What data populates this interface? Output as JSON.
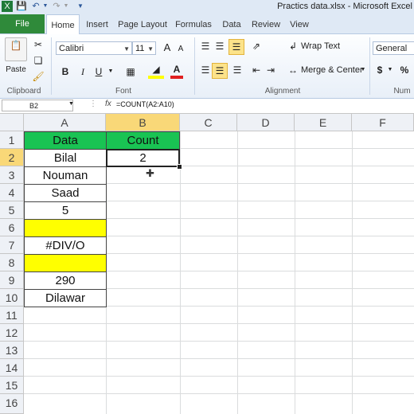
{
  "window": {
    "title": "Practics data.xlsx - Microsoft Excel"
  },
  "tabs": [
    "File",
    "Home",
    "Insert",
    "Page Layout",
    "Formulas",
    "Data",
    "Review",
    "View"
  ],
  "active_tab": "Home",
  "ribbon": {
    "clipboard": {
      "paste": "Paste",
      "label": "Clipboard"
    },
    "font": {
      "family": "Calibri",
      "size": "11",
      "label": "Font",
      "bold": "B",
      "italic": "I",
      "underline": "U",
      "grow": "A",
      "shrink": "A",
      "font_color_letter": "A"
    },
    "alignment": {
      "wrap_text": "Wrap Text",
      "merge_center": "Merge & Center",
      "label": "Alignment"
    },
    "number": {
      "format": "General",
      "currency": "$",
      "percent": "%",
      "label": "Num"
    }
  },
  "formula_bar": {
    "name_box": "B2",
    "fx": "fx",
    "formula": "=COUNT(A2:A10)"
  },
  "columns": [
    "A",
    "B",
    "C",
    "D",
    "E",
    "F"
  ],
  "rows": [
    "1",
    "2",
    "3",
    "4",
    "5",
    "6",
    "7",
    "8",
    "9",
    "10",
    "11",
    "12",
    "13",
    "14",
    "15",
    "16"
  ],
  "cells": {
    "A1": "Data",
    "B1": "Count",
    "A2": "Bilal",
    "B2": "2",
    "A3": "Nouman",
    "A4": "Saad",
    "A5": "5",
    "A6": "",
    "A7": "#DIV/O",
    "A8": "",
    "A9": "290",
    "A10": "Dilawar"
  },
  "colors": {
    "header_green": "#19c353",
    "highlight_yellow": "#ffff00",
    "file_tab": "#2f8a3a",
    "selected_header": "#f9d878"
  }
}
